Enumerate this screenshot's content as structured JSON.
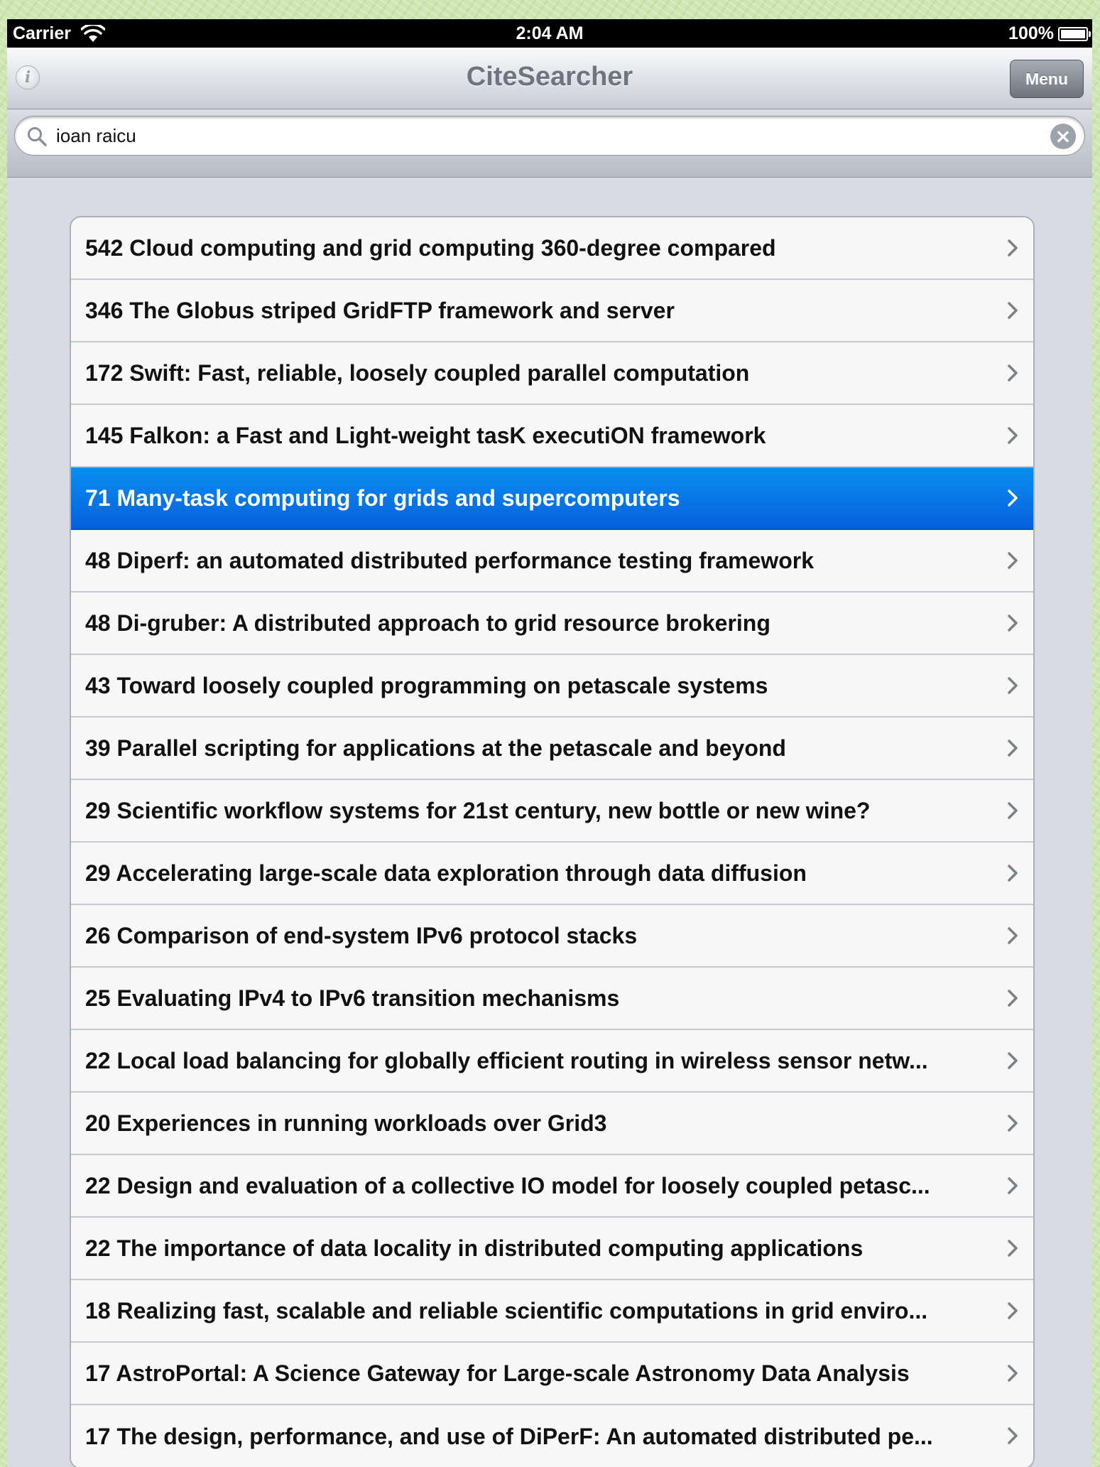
{
  "status_bar": {
    "carrier": "Carrier",
    "time": "2:04 AM",
    "battery": "100%",
    "battery_level": 1.0
  },
  "nav_bar": {
    "title": "CiteSearcher",
    "info_glyph": "i",
    "menu_label": "Menu"
  },
  "search": {
    "query": "ioan raicu",
    "clear_glyph": "×"
  },
  "colors": {
    "selected_row": "#0a6ee8",
    "background": "#cfe6b4"
  },
  "results": [
    {
      "title": "542 Cloud computing and grid computing 360-degree compared",
      "selected": false
    },
    {
      "title": "346 The Globus striped GridFTP framework and server",
      "selected": false
    },
    {
      "title": "172 Swift: Fast, reliable, loosely coupled parallel computation",
      "selected": false
    },
    {
      "title": "145 Falkon: a Fast and Light-weight tasK executiON framework",
      "selected": false
    },
    {
      "title": "71 Many-task computing for grids and supercomputers",
      "selected": true
    },
    {
      "title": "48 Diperf: an automated distributed performance testing framework",
      "selected": false
    },
    {
      "title": "48 Di-gruber: A distributed approach to grid resource brokering",
      "selected": false
    },
    {
      "title": "43 Toward loosely coupled programming on petascale systems",
      "selected": false
    },
    {
      "title": "39 Parallel scripting for applications at the petascale and beyond",
      "selected": false
    },
    {
      "title": "29 Scientific workflow systems for 21st century, new bottle or new wine?",
      "selected": false
    },
    {
      "title": "29 Accelerating large-scale data exploration through data diffusion",
      "selected": false
    },
    {
      "title": "26 Comparison of end-system IPv6 protocol stacks",
      "selected": false
    },
    {
      "title": "25 Evaluating IPv4 to IPv6 transition mechanisms",
      "selected": false
    },
    {
      "title": "22 Local load balancing for globally efficient routing in wireless sensor netw...",
      "selected": false
    },
    {
      "title": "20 Experiences in running workloads over Grid3",
      "selected": false
    },
    {
      "title": "22 Design and evaluation of a collective IO model for loosely coupled petasc...",
      "selected": false
    },
    {
      "title": "22 The importance of data locality in distributed computing applications",
      "selected": false
    },
    {
      "title": "18 Realizing fast, scalable and reliable scientific computations in grid enviro...",
      "selected": false
    },
    {
      "title": "17 AstroPortal: A Science Gateway for Large-scale Astronomy Data Analysis",
      "selected": false
    },
    {
      "title": "17 The design, performance, and use of DiPerF: An automated distributed pe...",
      "selected": false
    }
  ]
}
